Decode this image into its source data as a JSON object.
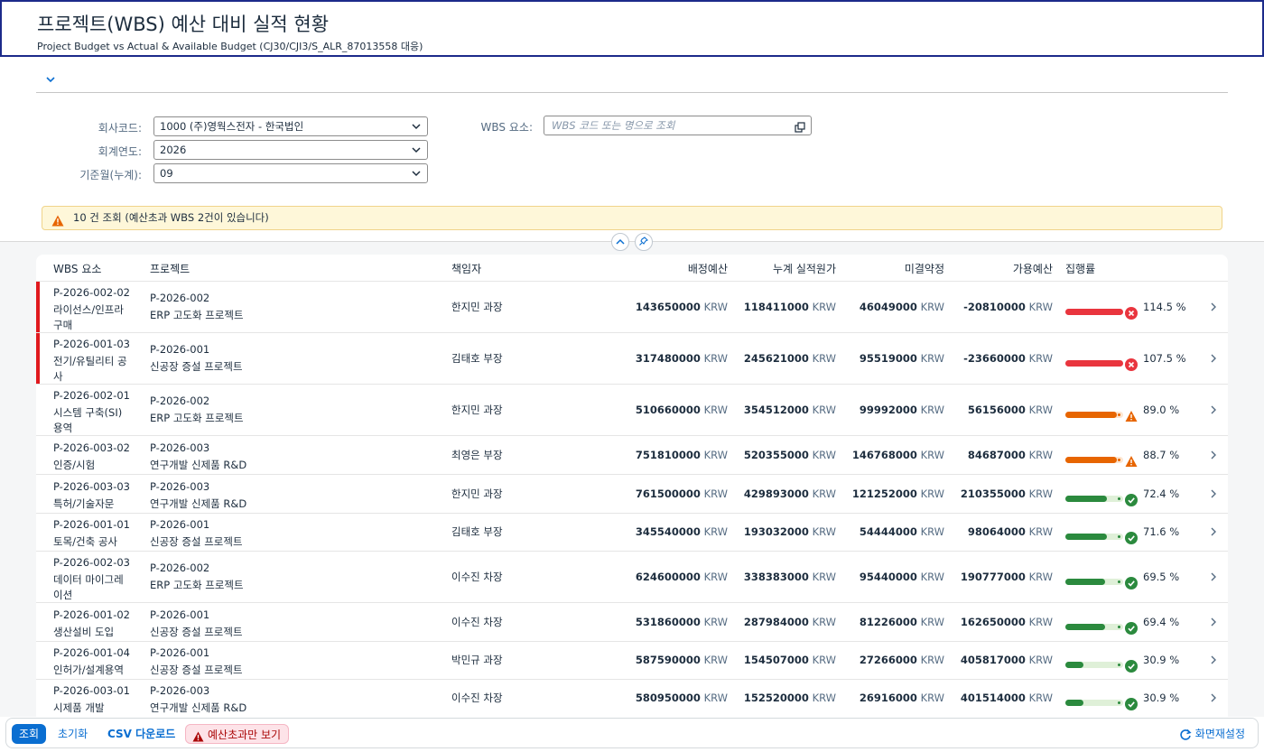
{
  "header": {
    "title": "프로젝트(WBS) 예산 대비 실적 현황",
    "subtitle": "Project Budget vs Actual & Available Budget (CJ30/CJI3/S_ALR_87013558 대응)"
  },
  "filters": {
    "company_label": "회사코드:",
    "company_value": "1000 (주)영웍스전자 - 한국법인",
    "year_label": "회계연도:",
    "year_value": "2026",
    "period_label": "기준월(누계):",
    "period_value": "09",
    "wbs_label": "WBS 요소:",
    "wbs_placeholder": "WBS 코드 또는 명으로 조회"
  },
  "message": "10 건 조회 (예산초과 WBS 2건이 있습니다)",
  "table": {
    "columns": [
      "WBS 요소",
      "프로젝트",
      "책임자",
      "배정예산",
      "누계 실적원가",
      "미결약정",
      "가용예산",
      "집행률"
    ],
    "currency": "KRW",
    "rows": [
      {
        "wbs": "P-2026-002-02",
        "wbs_name1": "라이선스/인프라",
        "wbs_name2": "구매",
        "proj": "P-2026-002",
        "proj_name": "ERP 고도화 프로젝트",
        "owner": "한지민 과장",
        "budget": "143650000",
        "actual": "118411000",
        "commit": "46049000",
        "avail": "-20810000",
        "rate": "114.5 %",
        "pct": 1.0,
        "status": "error",
        "over": true
      },
      {
        "wbs": "P-2026-001-03",
        "wbs_name1": "전기/유틸리티 공",
        "wbs_name2": "사",
        "proj": "P-2026-001",
        "proj_name": "신공장 증설 프로젝트",
        "owner": "김태호 부장",
        "budget": "317480000",
        "actual": "245621000",
        "commit": "95519000",
        "avail": "-23660000",
        "rate": "107.5 %",
        "pct": 1.0,
        "status": "error",
        "over": true
      },
      {
        "wbs": "P-2026-002-01",
        "wbs_name1": "시스템 구축(SI)",
        "wbs_name2": "용역",
        "proj": "P-2026-002",
        "proj_name": "ERP 고도화 프로젝트",
        "owner": "한지민 과장",
        "budget": "510660000",
        "actual": "354512000",
        "commit": "99992000",
        "avail": "56156000",
        "rate": "89.0 %",
        "pct": 0.89,
        "status": "warning",
        "over": false
      },
      {
        "wbs": "P-2026-003-02",
        "wbs_name1": "인증/시험",
        "wbs_name2": "",
        "proj": "P-2026-003",
        "proj_name": "연구개발 신제품 R&D",
        "owner": "최영은 부장",
        "budget": "751810000",
        "actual": "520355000",
        "commit": "146768000",
        "avail": "84687000",
        "rate": "88.7 %",
        "pct": 0.887,
        "status": "warning",
        "over": false
      },
      {
        "wbs": "P-2026-003-03",
        "wbs_name1": "특허/기술자문",
        "wbs_name2": "",
        "proj": "P-2026-003",
        "proj_name": "연구개발 신제품 R&D",
        "owner": "한지민 과장",
        "budget": "761500000",
        "actual": "429893000",
        "commit": "121252000",
        "avail": "210355000",
        "rate": "72.4 %",
        "pct": 0.724,
        "status": "success",
        "over": false
      },
      {
        "wbs": "P-2026-001-01",
        "wbs_name1": "토목/건축 공사",
        "wbs_name2": "",
        "proj": "P-2026-001",
        "proj_name": "신공장 증설 프로젝트",
        "owner": "김태호 부장",
        "budget": "345540000",
        "actual": "193032000",
        "commit": "54444000",
        "avail": "98064000",
        "rate": "71.6 %",
        "pct": 0.716,
        "status": "success",
        "over": false
      },
      {
        "wbs": "P-2026-002-03",
        "wbs_name1": "데이터 마이그레",
        "wbs_name2": "이션",
        "proj": "P-2026-002",
        "proj_name": "ERP 고도화 프로젝트",
        "owner": "이수진 차장",
        "budget": "624600000",
        "actual": "338383000",
        "commit": "95440000",
        "avail": "190777000",
        "rate": "69.5 %",
        "pct": 0.695,
        "status": "success",
        "over": false
      },
      {
        "wbs": "P-2026-001-02",
        "wbs_name1": "생산설비 도입",
        "wbs_name2": "",
        "proj": "P-2026-001",
        "proj_name": "신공장 증설 프로젝트",
        "owner": "이수진 차장",
        "budget": "531860000",
        "actual": "287984000",
        "commit": "81226000",
        "avail": "162650000",
        "rate": "69.4 %",
        "pct": 0.694,
        "status": "success",
        "over": false
      },
      {
        "wbs": "P-2026-001-04",
        "wbs_name1": "인허가/설계용역",
        "wbs_name2": "",
        "proj": "P-2026-001",
        "proj_name": "신공장 증설 프로젝트",
        "owner": "박민규 과장",
        "budget": "587590000",
        "actual": "154507000",
        "commit": "27266000",
        "avail": "405817000",
        "rate": "30.9 %",
        "pct": 0.309,
        "status": "success",
        "over": false
      },
      {
        "wbs": "P-2026-003-01",
        "wbs_name1": "시제품 개발",
        "wbs_name2": "",
        "proj": "P-2026-003",
        "proj_name": "연구개발 신제품 R&D",
        "owner": "이수진 차장",
        "budget": "580950000",
        "actual": "152520000",
        "commit": "26916000",
        "avail": "401514000",
        "rate": "30.9 %",
        "pct": 0.309,
        "status": "success",
        "over": false
      }
    ]
  },
  "footer": {
    "search": "조회",
    "reset": "초기화",
    "csv": "CSV 다운로드",
    "over_only": "예산초과만 보기",
    "adapt": "화면재설정"
  },
  "colors": {
    "error": "#e9353e",
    "warning": "#e76500",
    "success": "#2b8a3e",
    "accent": "#0a6ed1"
  }
}
